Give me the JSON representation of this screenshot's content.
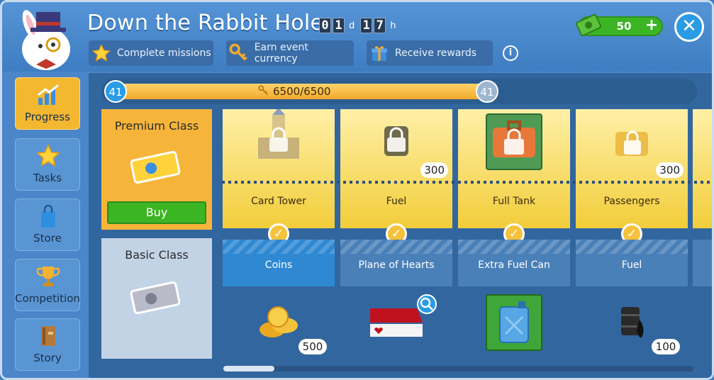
{
  "header": {
    "title": "Down the Rabbit Hole",
    "timer": {
      "d1": "0",
      "d2": "1",
      "unit_d": "d",
      "h1": "1",
      "h2": "7",
      "unit_h": "h"
    },
    "chips": [
      {
        "label": "Complete missions",
        "icon": "star-icon"
      },
      {
        "label": "Earn event currency",
        "icon": "key-icon"
      },
      {
        "label": "Receive rewards",
        "icon": "gift-icon"
      }
    ],
    "info_label": "i",
    "money": "50",
    "plus_label": "+",
    "close_label": "✕"
  },
  "sidebar": {
    "items": [
      {
        "label": "Progress",
        "icon": "progress-chart-icon",
        "active": true
      },
      {
        "label": "Tasks",
        "icon": "star-icon"
      },
      {
        "label": "Store",
        "icon": "shopping-bag-icon"
      },
      {
        "label": "Competition",
        "icon": "trophy-icon"
      },
      {
        "label": "Story",
        "icon": "book-icon"
      }
    ]
  },
  "progress": {
    "level_left": "41",
    "level_right": "41",
    "text": "6500/6500",
    "fraction": 1.0
  },
  "classes": {
    "premium": {
      "title": "Premium Class",
      "buy_label": "Buy"
    },
    "basic": {
      "title": "Basic Class"
    }
  },
  "premium_rewards": [
    {
      "name": "Card Tower",
      "icon": "card-tower-icon",
      "count": ""
    },
    {
      "name": "Fuel",
      "icon": "fuel-barrel-icon",
      "count": "300"
    },
    {
      "name": "Full Tank",
      "icon": "suitcase-icon",
      "count": ""
    },
    {
      "name": "Passengers",
      "icon": "passengers-icon",
      "count": "300"
    }
  ],
  "basic_rewards": [
    {
      "name": "Coins",
      "icon": "coins-icon",
      "count": "500"
    },
    {
      "name": "Plane of Hearts",
      "icon": "plane-of-hearts-icon",
      "count": ""
    },
    {
      "name": "Extra Fuel Can",
      "icon": "fuel-can-icon",
      "count": ""
    },
    {
      "name": "Fuel",
      "icon": "oil-barrel-icon",
      "count": "100"
    }
  ],
  "check_mark": "✓"
}
